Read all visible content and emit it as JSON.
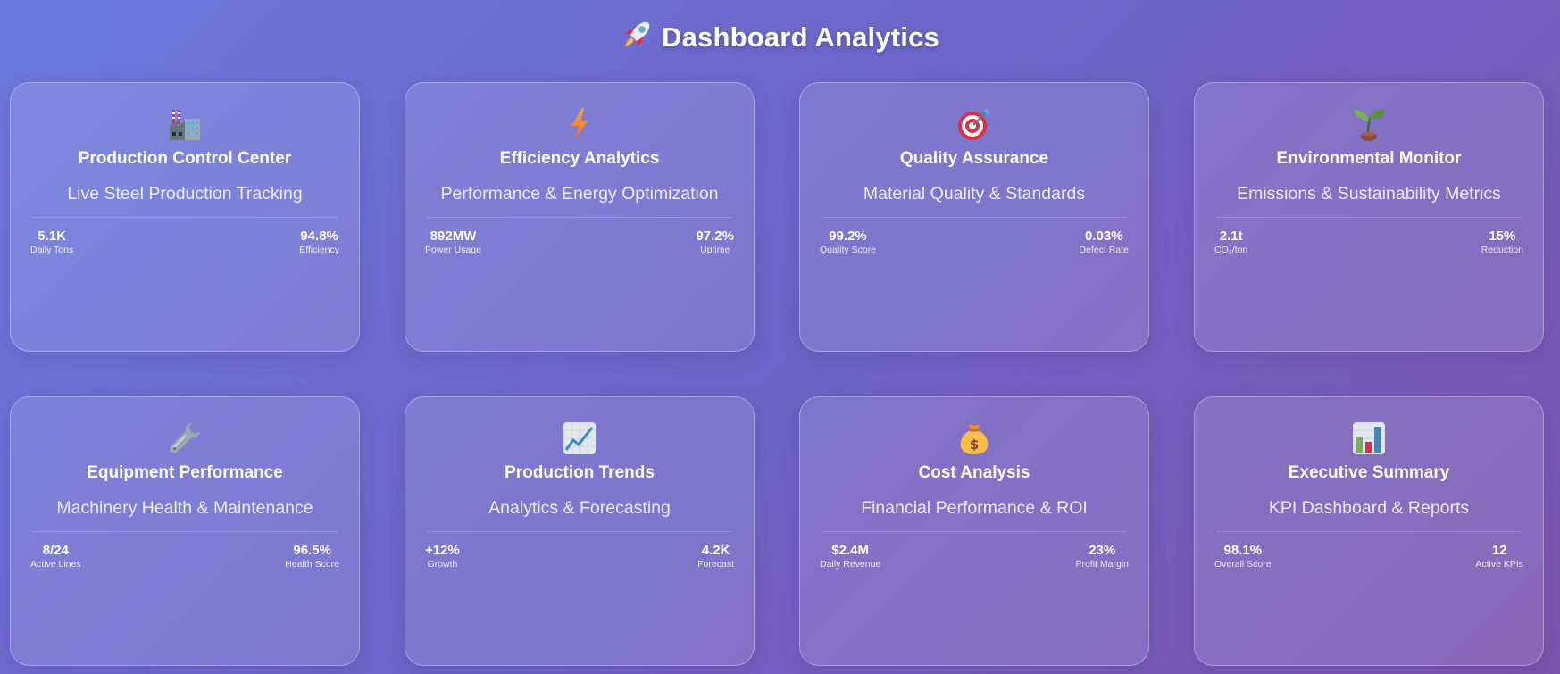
{
  "header": {
    "icon": "rocket-icon",
    "title": "Dashboard Analytics"
  },
  "cards": [
    {
      "icon": "factory-icon",
      "title": "Production Control Center",
      "subtitle": "Live Steel Production Tracking",
      "stats": [
        {
          "value": "5.1K",
          "label": "Daily Tons"
        },
        {
          "value": "94.8%",
          "label": "Efficiency"
        }
      ]
    },
    {
      "icon": "lightning-icon",
      "title": "Efficiency Analytics",
      "subtitle": "Performance & Energy Optimization",
      "stats": [
        {
          "value": "892MW",
          "label": "Power Usage"
        },
        {
          "value": "97.2%",
          "label": "Uptime"
        }
      ]
    },
    {
      "icon": "target-icon",
      "title": "Quality Assurance",
      "subtitle": "Material Quality & Standards",
      "stats": [
        {
          "value": "99.2%",
          "label": "Quality Score"
        },
        {
          "value": "0.03%",
          "label": "Defect Rate"
        }
      ]
    },
    {
      "icon": "seedling-icon",
      "title": "Environmental Monitor",
      "subtitle": "Emissions & Sustainability Metrics",
      "stats": [
        {
          "value": "2.1t",
          "label": "CO₂/ton"
        },
        {
          "value": "15%",
          "label": "Reduction"
        }
      ]
    },
    {
      "icon": "wrench-icon",
      "title": "Equipment Performance",
      "subtitle": "Machinery Health & Maintenance",
      "stats": [
        {
          "value": "8/24",
          "label": "Active Lines"
        },
        {
          "value": "96.5%",
          "label": "Health Score"
        }
      ]
    },
    {
      "icon": "chart-increasing-icon",
      "title": "Production Trends",
      "subtitle": "Analytics & Forecasting",
      "stats": [
        {
          "value": "+12%",
          "label": "Growth"
        },
        {
          "value": "4.2K",
          "label": "Forecast"
        }
      ]
    },
    {
      "icon": "money-bag-icon",
      "title": "Cost Analysis",
      "subtitle": "Financial Performance & ROI",
      "stats": [
        {
          "value": "$2.4M",
          "label": "Daily Revenue"
        },
        {
          "value": "23%",
          "label": "Profit Margin"
        }
      ]
    },
    {
      "icon": "bar-chart-icon",
      "title": "Executive Summary",
      "subtitle": "KPI Dashboard & Reports",
      "stats": [
        {
          "value": "98.1%",
          "label": "Overall Score"
        },
        {
          "value": "12",
          "label": "Active KPIs"
        }
      ]
    }
  ],
  "colors": {
    "background_start": "#6b79dd",
    "background_end": "#7a55ae",
    "text": "#ffffff"
  }
}
